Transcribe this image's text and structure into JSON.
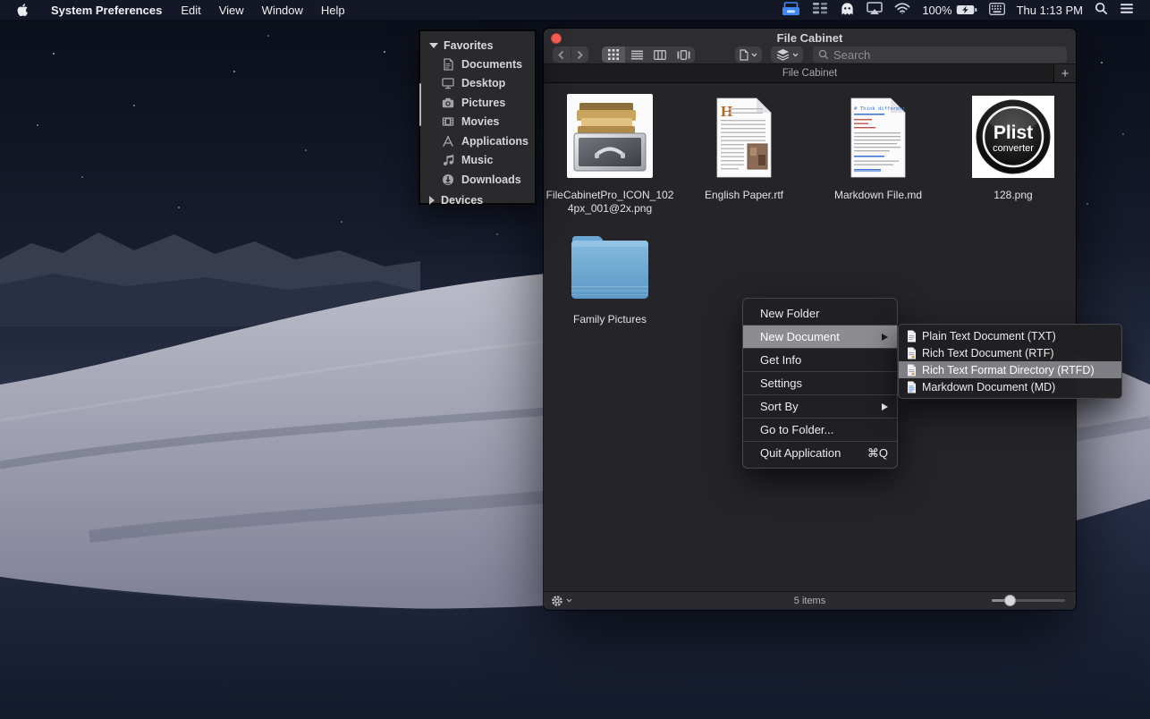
{
  "menu_bar": {
    "app_name": "System Preferences",
    "menus": [
      "Edit",
      "View",
      "Window",
      "Help"
    ],
    "status": {
      "battery_percent": "100%",
      "clock": "Thu 1:13 PM"
    },
    "status_icons": [
      "file-cabinet-icon",
      "stacks-icon",
      "ghost-icon",
      "airplay-icon",
      "wifi-icon",
      "battery-icon",
      "keyboard-icon",
      "spotlight-icon",
      "notification-list-icon"
    ]
  },
  "sidebar_panel": {
    "favorites": {
      "label": "Favorites",
      "items": [
        {
          "label": "Documents",
          "icon": "document-icon"
        },
        {
          "label": "Desktop",
          "icon": "desktop-icon"
        },
        {
          "label": "Pictures",
          "icon": "camera-icon"
        },
        {
          "label": "Movies",
          "icon": "film-icon"
        },
        {
          "label": "Applications",
          "icon": "applications-icon"
        },
        {
          "label": "Music",
          "icon": "music-note-icon"
        },
        {
          "label": "Downloads",
          "icon": "download-circle-icon"
        }
      ]
    },
    "devices": {
      "label": "Devices"
    }
  },
  "window": {
    "title": "File Cabinet",
    "tab": {
      "label": "File Cabinet",
      "add_button": "+"
    },
    "toolbar": {
      "search_placeholder": "Search"
    },
    "files": [
      {
        "name": "FileCabinetPro_ICON_1024px_001@2x.png",
        "icon": "cabinet-image-thumbnail"
      },
      {
        "name": "English Paper.rtf",
        "icon": "rtf-document-icon"
      },
      {
        "name": "Markdown File.md",
        "icon": "markdown-document-icon"
      },
      {
        "name": "128.png",
        "icon": "plist-converter-thumbnail"
      },
      {
        "name": "Family Pictures",
        "icon": "blue-folder-icon"
      }
    ],
    "status_bar": {
      "items_count": "5 items"
    }
  },
  "context_menu": {
    "items": [
      {
        "label": "New Folder"
      },
      {
        "label": "New Document",
        "has_submenu": true,
        "highlighted": true
      },
      {
        "label": "Get Info"
      },
      {
        "label": "Settings"
      },
      {
        "label": "Sort By",
        "has_submenu": true
      },
      {
        "label": "Go to Folder..."
      },
      {
        "label": "Quit Application",
        "shortcut": "⌘Q"
      }
    ]
  },
  "submenu": {
    "items": [
      {
        "label": "Plain Text Document (TXT)",
        "icon": "text-document-icon"
      },
      {
        "label": "Rich Text Document (RTF)",
        "icon": "rtf-page-icon"
      },
      {
        "label": "Rich Text Format Directory (RTFD)",
        "icon": "rtfd-page-icon",
        "highlighted": true
      },
      {
        "label": "Markdown Document (MD)",
        "icon": "md-page-icon"
      }
    ]
  },
  "colors": {
    "close_button_red": "#f95e56",
    "folder_blue": "#6fa8d4",
    "menu_highlight_gray": "#8c8c91",
    "menubar_app_icon_blue": "#3f87f5"
  }
}
